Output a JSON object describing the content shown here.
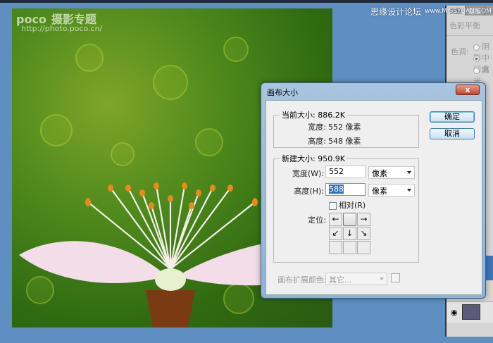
{
  "watermark": {
    "brand": "poco",
    "brand_cn": "摄影专题",
    "url": "http://photo.poco.cn/"
  },
  "site": {
    "name": "思缘设计论坛",
    "url": "www.MISSYUAN.COM"
  },
  "panel": {
    "tabs": [
      "调整",
      "蒙版"
    ],
    "title": "色彩平衡",
    "tone_label": "色调:",
    "tones": [
      {
        "label": "阴影",
        "checked": false
      },
      {
        "label": "中间调",
        "checked": true
      },
      {
        "label": "高光",
        "checked": false
      }
    ]
  },
  "dialog": {
    "title": "画布大小",
    "close": "x",
    "current": {
      "legend": "当前大小: 886.2K",
      "width_label": "宽度:",
      "width_value": "552 像素",
      "height_label": "高度:",
      "height_value": "548 像素"
    },
    "new": {
      "legend": "新建大小: 950.9K",
      "width_label": "宽度(W):",
      "width_value": "552",
      "width_unit": "像素",
      "height_label": "高度(H):",
      "height_value": "588",
      "height_unit": "像素",
      "relative_label": "相对(R)",
      "relative_checked": false,
      "anchor_label": "定位:",
      "anchor_cells": [
        "←",
        "",
        "→",
        "↙",
        "↓",
        "↘",
        "",
        "",
        ""
      ]
    },
    "ext_color_label": "画布扩展颜色:",
    "ext_color_value": "其它...",
    "ok": "确定",
    "cancel": "取消"
  },
  "colors": {
    "workspace": "#5f8fc2",
    "dialog_frame": "#8fb3d6",
    "selection": "#3170c6"
  }
}
